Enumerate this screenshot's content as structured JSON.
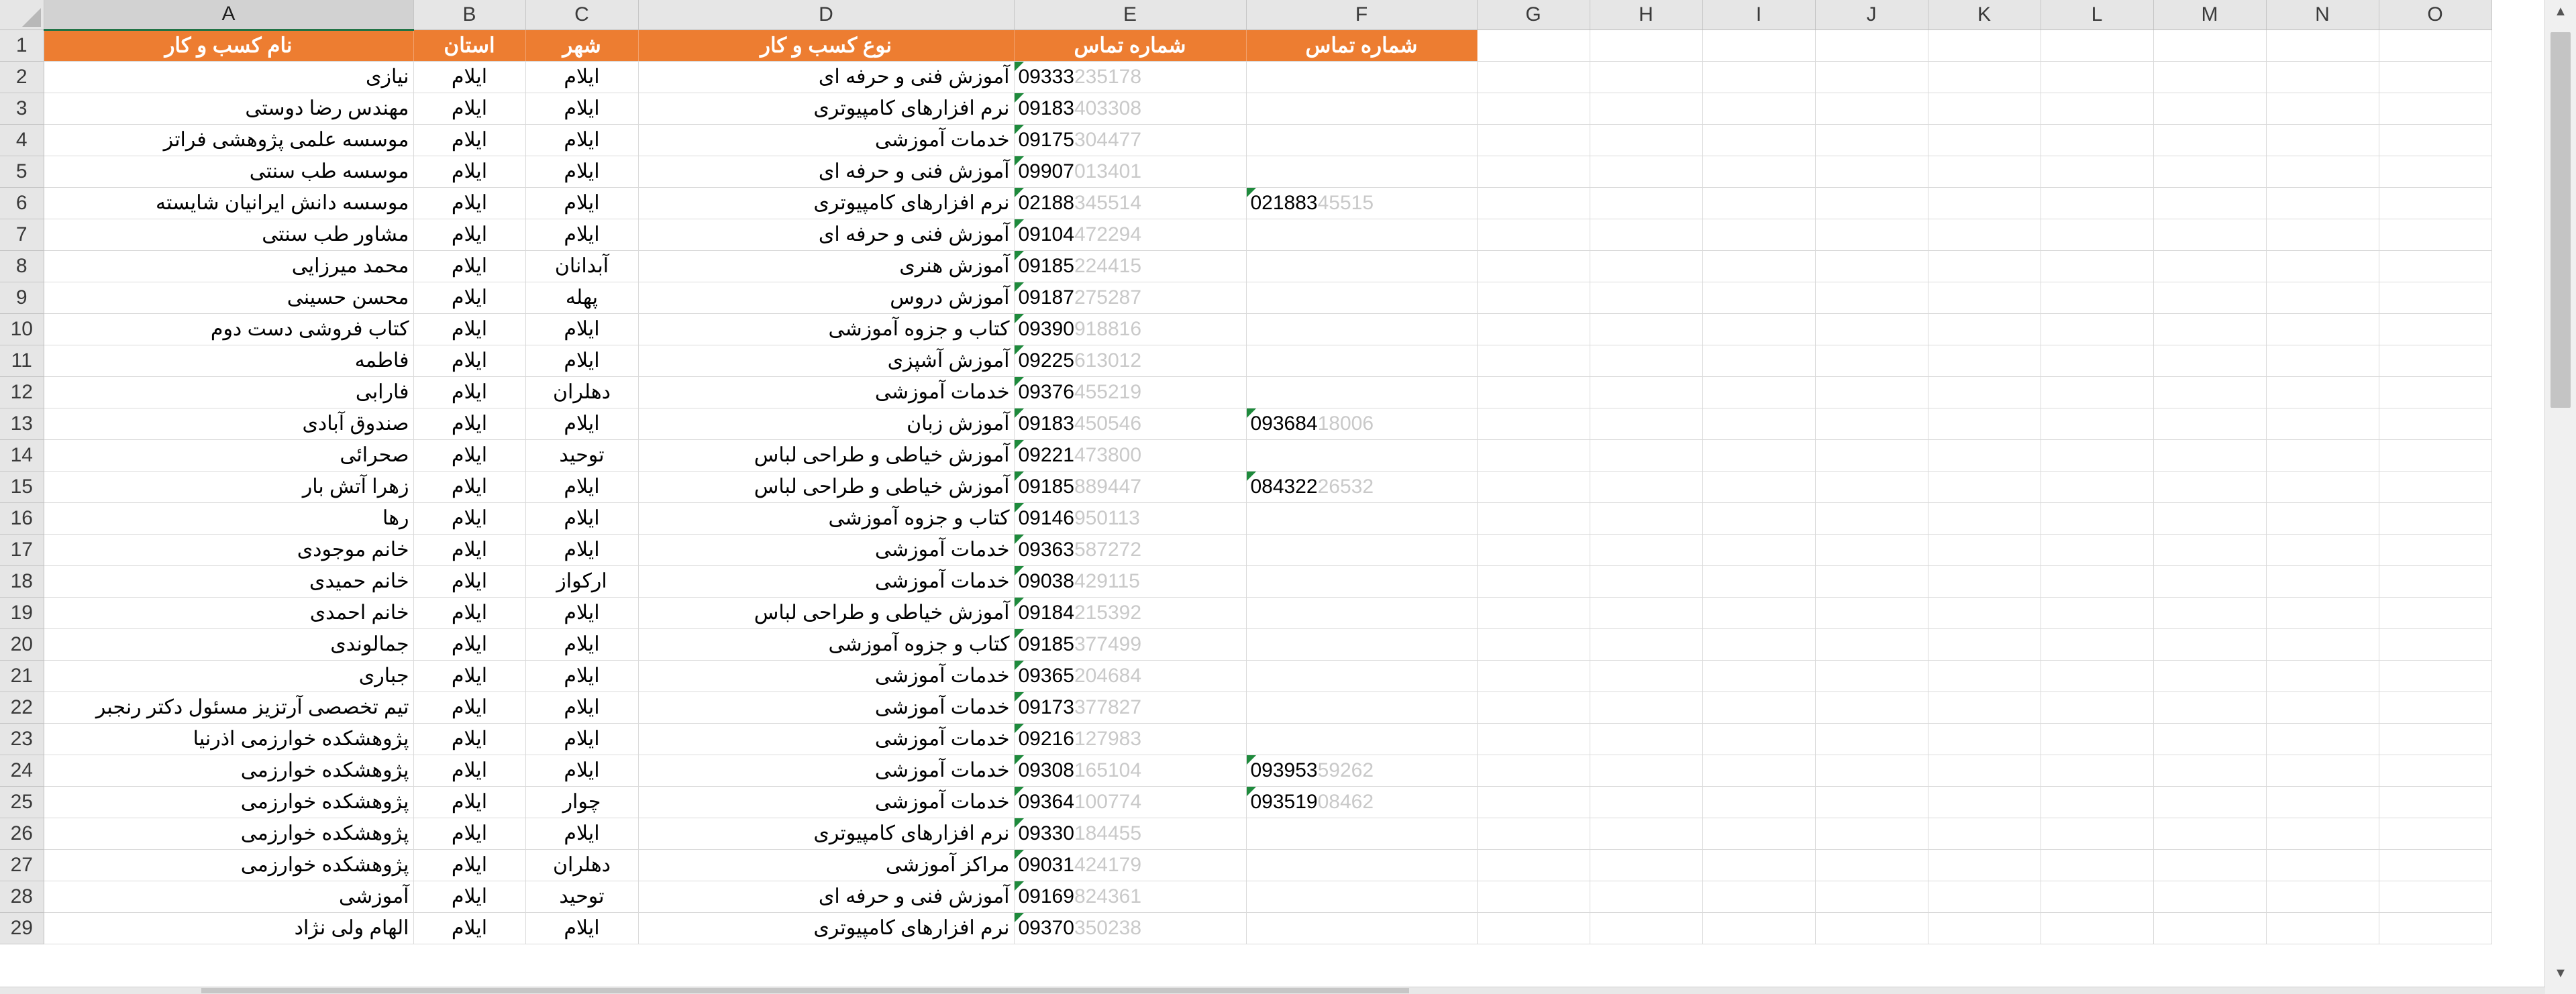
{
  "columns": [
    "A",
    "B",
    "C",
    "D",
    "E",
    "F",
    "G",
    "H",
    "I",
    "J",
    "K",
    "L",
    "M",
    "N",
    "O"
  ],
  "header": {
    "name": "نام کسب و کار",
    "province": "استان",
    "city": "شهر",
    "type": "نوع کسب و کار",
    "phone1": "شماره تماس",
    "phone2": "شماره تماس"
  },
  "rows": [
    {
      "num": "2",
      "name": "نیازی",
      "province": "ایلام",
      "city": "ایلام",
      "type": "آموزش فنی و حرفه ای",
      "p1a": "09333",
      "p1b": "235178",
      "p2a": "",
      "p2b": ""
    },
    {
      "num": "3",
      "name": "مهندس رضا دوستی",
      "province": "ایلام",
      "city": "ایلام",
      "type": "نرم افزارهای کامپیوتری",
      "p1a": "09183",
      "p1b": "403308",
      "p2a": "",
      "p2b": ""
    },
    {
      "num": "4",
      "name": "موسسه علمی پژوهشی فراتز",
      "province": "ایلام",
      "city": "ایلام",
      "type": "خدمات آموزشی",
      "p1a": "09175",
      "p1b": "304477",
      "p2a": "",
      "p2b": ""
    },
    {
      "num": "5",
      "name": "موسسه طب سنتی",
      "province": "ایلام",
      "city": "ایلام",
      "type": "آموزش فنی و حرفه ای",
      "p1a": "09907",
      "p1b": "013401",
      "p2a": "",
      "p2b": ""
    },
    {
      "num": "6",
      "name": "موسسه دانش ایرانیان شایسته",
      "province": "ایلام",
      "city": "ایلام",
      "type": "نرم افزارهای کامپیوتری",
      "p1a": "02188",
      "p1b": "345514",
      "p2a": "021883",
      "p2b": "45515"
    },
    {
      "num": "7",
      "name": "مشاور طب سنتی",
      "province": "ایلام",
      "city": "ایلام",
      "type": "آموزش فنی و حرفه ای",
      "p1a": "09104",
      "p1b": "472294",
      "p2a": "",
      "p2b": ""
    },
    {
      "num": "8",
      "name": "محمد میرزایی",
      "province": "ایلام",
      "city": "آبدانان",
      "type": "آموزش هنری",
      "p1a": "09185",
      "p1b": "224415",
      "p2a": "",
      "p2b": ""
    },
    {
      "num": "9",
      "name": "محسن حسینی",
      "province": "ایلام",
      "city": "پهله",
      "type": "آموزش دروس",
      "p1a": "09187",
      "p1b": "275287",
      "p2a": "",
      "p2b": ""
    },
    {
      "num": "10",
      "name": "کتاب فروشی دست دوم",
      "province": "ایلام",
      "city": "ایلام",
      "type": "کتاب و جزوه آموزشی",
      "p1a": "09390",
      "p1b": "918816",
      "p2a": "",
      "p2b": ""
    },
    {
      "num": "11",
      "name": "فاطمه",
      "province": "ایلام",
      "city": "ایلام",
      "type": "آموزش آشپزی",
      "p1a": "09225",
      "p1b": "613012",
      "p2a": "",
      "p2b": ""
    },
    {
      "num": "12",
      "name": "فارابی",
      "province": "ایلام",
      "city": "دهلران",
      "type": "خدمات آموزشی",
      "p1a": "09376",
      "p1b": "455219",
      "p2a": "",
      "p2b": ""
    },
    {
      "num": "13",
      "name": "صندوق آبادی",
      "province": "ایلام",
      "city": "ایلام",
      "type": "آموزش زبان",
      "p1a": "09183",
      "p1b": "450546",
      "p2a": "093684",
      "p2b": "18006"
    },
    {
      "num": "14",
      "name": "صحرائی",
      "province": "ایلام",
      "city": "توحید",
      "type": "آموزش خیاطی و طراحی لباس",
      "p1a": "09221",
      "p1b": "473800",
      "p2a": "",
      "p2b": ""
    },
    {
      "num": "15",
      "name": "زهرا آتش بار",
      "province": "ایلام",
      "city": "ایلام",
      "type": "آموزش خیاطی و طراحی لباس",
      "p1a": "09185",
      "p1b": "889447",
      "p2a": "084322",
      "p2b": "26532"
    },
    {
      "num": "16",
      "name": "رها",
      "province": "ایلام",
      "city": "ایلام",
      "type": "کتاب و جزوه آموزشی",
      "p1a": "09146",
      "p1b": "950113",
      "p2a": "",
      "p2b": ""
    },
    {
      "num": "17",
      "name": "خانم موجودی",
      "province": "ایلام",
      "city": "ایلام",
      "type": "خدمات آموزشی",
      "p1a": "09363",
      "p1b": "587272",
      "p2a": "",
      "p2b": ""
    },
    {
      "num": "18",
      "name": "خانم حمیدی",
      "province": "ایلام",
      "city": "ارکواز",
      "type": "خدمات آموزشی",
      "p1a": "09038",
      "p1b": "429115",
      "p2a": "",
      "p2b": ""
    },
    {
      "num": "19",
      "name": "خانم احمدی",
      "province": "ایلام",
      "city": "ایلام",
      "type": "آموزش خیاطی و طراحی لباس",
      "p1a": "09184",
      "p1b": "215392",
      "p2a": "",
      "p2b": ""
    },
    {
      "num": "20",
      "name": "جمالوندی",
      "province": "ایلام",
      "city": "ایلام",
      "type": "کتاب و جزوه آموزشی",
      "p1a": "09185",
      "p1b": "377499",
      "p2a": "",
      "p2b": ""
    },
    {
      "num": "21",
      "name": "جباری",
      "province": "ایلام",
      "city": "ایلام",
      "type": "خدمات آموزشی",
      "p1a": "09365",
      "p1b": "204684",
      "p2a": "",
      "p2b": ""
    },
    {
      "num": "22",
      "name": "تیم تخصصی آرتزیز مسئول دکتر رنجبر",
      "province": "ایلام",
      "city": "ایلام",
      "type": "خدمات آموزشی",
      "p1a": "09173",
      "p1b": "377827",
      "p2a": "",
      "p2b": ""
    },
    {
      "num": "23",
      "name": "پژوهشکده خوارزمی اذرنیا",
      "province": "ایلام",
      "city": "ایلام",
      "type": "خدمات آموزشی",
      "p1a": "09216",
      "p1b": "127983",
      "p2a": "",
      "p2b": ""
    },
    {
      "num": "24",
      "name": "پژوهشکده خوارزمی",
      "province": "ایلام",
      "city": "ایلام",
      "type": "خدمات آموزشی",
      "p1a": "09308",
      "p1b": "165104",
      "p2a": "093953",
      "p2b": "59262"
    },
    {
      "num": "25",
      "name": "پژوهشکده خوارزمی",
      "province": "ایلام",
      "city": "چوار",
      "type": "خدمات آموزشی",
      "p1a": "09364",
      "p1b": "100774",
      "p2a": "093519",
      "p2b": "08462"
    },
    {
      "num": "26",
      "name": "پژوهشکده خوارزمی",
      "province": "ایلام",
      "city": "ایلام",
      "type": "نرم افزارهای کامپیوتری",
      "p1a": "09330",
      "p1b": "184455",
      "p2a": "",
      "p2b": ""
    },
    {
      "num": "27",
      "name": "پژوهشکده خوارزمی",
      "province": "ایلام",
      "city": "دهلران",
      "type": "مراکز آموزشی",
      "p1a": "09031",
      "p1b": "424179",
      "p2a": "",
      "p2b": ""
    },
    {
      "num": "28",
      "name": "آموزشی",
      "province": "ایلام",
      "city": "توحید",
      "type": "آموزش فنی و حرفه ای",
      "p1a": "09169",
      "p1b": "824361",
      "p2a": "",
      "p2b": ""
    },
    {
      "num": "29",
      "name": "الهام ولی نژاد",
      "province": "ایلام",
      "city": "ایلام",
      "type": "نرم افزارهای کامپیوتری",
      "p1a": "09370",
      "p1b": "350238",
      "p2a": "",
      "p2b": ""
    }
  ]
}
